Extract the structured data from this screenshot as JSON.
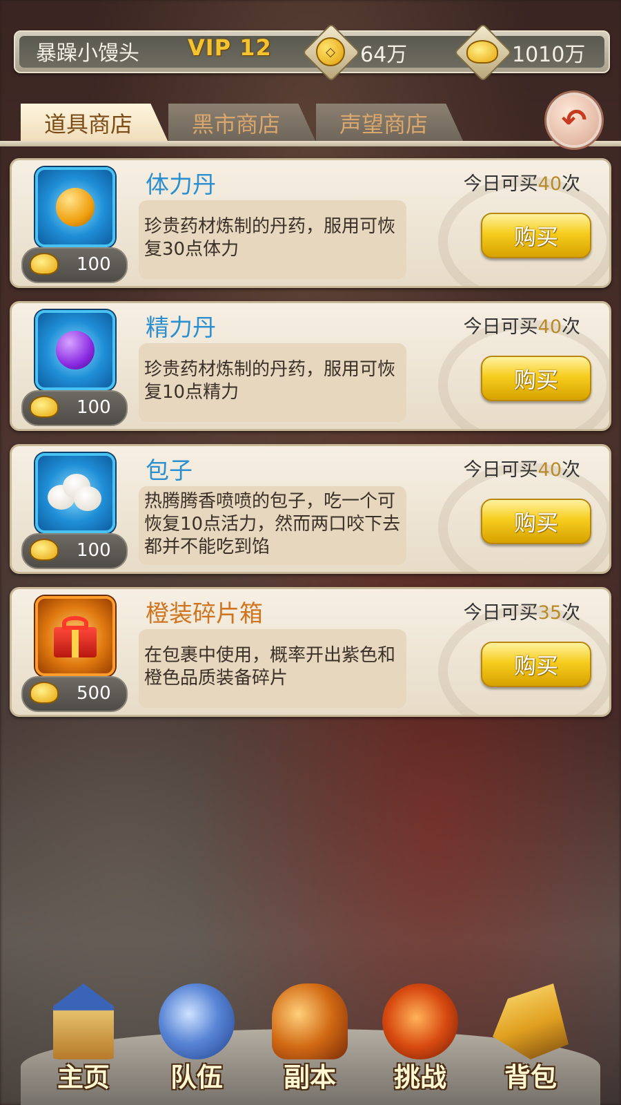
{
  "header": {
    "username": "暴躁小馒头",
    "vip": "VIP 12",
    "coin_icon": "copper-coin-icon",
    "coin_amount": "64万",
    "ingot_icon": "gold-ingot-icon",
    "ingot_amount": "1010万"
  },
  "tabs": [
    {
      "label": "道具商店",
      "active": true
    },
    {
      "label": "黑市商店",
      "active": false
    },
    {
      "label": "声望商店",
      "active": false
    }
  ],
  "back_icon": "back-arrow-icon",
  "items": [
    {
      "name": "体力丹",
      "limit_prefix": "今日可买",
      "limit_count": "40",
      "limit_suffix": "次",
      "desc": "珍贵药材炼制的丹药，服用可恢复30点体力",
      "price": "100",
      "buy_label": "购买",
      "icon": "orange-orb-icon",
      "orb_color": "#f0a010"
    },
    {
      "name": "精力丹",
      "limit_prefix": "今日可买",
      "limit_count": "40",
      "limit_suffix": "次",
      "desc": "珍贵药材炼制的丹药，服用可恢复10点精力",
      "price": "100",
      "buy_label": "购买",
      "icon": "purple-orb-icon",
      "orb_color": "#8a2be2"
    },
    {
      "name": "包子",
      "limit_prefix": "今日可买",
      "limit_count": "40",
      "limit_suffix": "次",
      "desc": "热腾腾香喷喷的包子，吃一个可恢复10点活力，然而两口咬下去都并不能吃到馅",
      "price": "100",
      "buy_label": "购买",
      "icon": "steamed-bun-icon",
      "orb_color": "#f4f1ea"
    },
    {
      "name": "橙装碎片箱",
      "limit_prefix": "今日可买",
      "limit_count": "35",
      "limit_suffix": "次",
      "desc": "在包裹中使用，概率开出紫色和橙色品质装备碎片",
      "price": "500",
      "buy_label": "购买",
      "icon": "gift-box-icon",
      "orb_color": "#d8281c"
    }
  ],
  "nav": [
    {
      "label": "主页",
      "icon": "palace-icon"
    },
    {
      "label": "队伍",
      "icon": "team-banner-icon"
    },
    {
      "label": "副本",
      "icon": "gourd-scroll-icon"
    },
    {
      "label": "挑战",
      "icon": "drum-icon"
    },
    {
      "label": "背包",
      "icon": "backpack-icon"
    }
  ],
  "colors": {
    "accent_gold": "#f6cd1e",
    "item_name_blue": "#2b8fd0",
    "item_name_orange": "#cf7520",
    "limit_number": "#b98a2a"
  }
}
